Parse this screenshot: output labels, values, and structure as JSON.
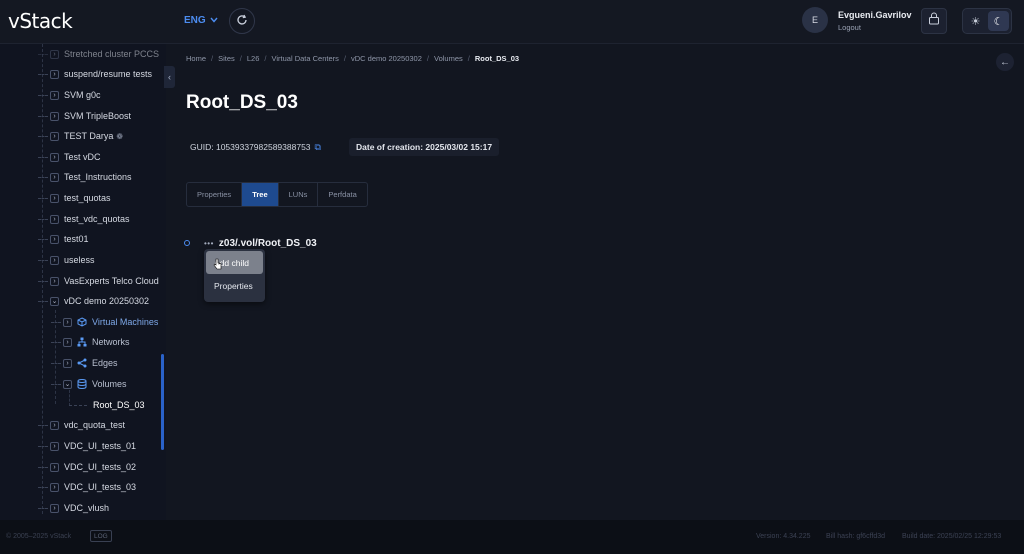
{
  "header": {
    "logo": "vStack",
    "lang": "ENG",
    "user_initial": "E",
    "username": "Evgueni.Gavrilov",
    "logout": "Logout"
  },
  "sidebar": {
    "items": [
      {
        "label": "Stretched cluster PCCS"
      },
      {
        "label": "suspend/resume tests"
      },
      {
        "label": "SVM g0c"
      },
      {
        "label": "SVM TripleBoost"
      },
      {
        "label": "TEST Darya"
      },
      {
        "label": "Test vDC"
      },
      {
        "label": "Test_Instructions"
      },
      {
        "label": "test_quotas"
      },
      {
        "label": "test_vdc_quotas"
      },
      {
        "label": "test01"
      },
      {
        "label": "useless"
      },
      {
        "label": "VasExperts Telco Cloud"
      },
      {
        "label": "vDC demo 20250302"
      },
      {
        "label": "Virtual Machines"
      },
      {
        "label": "Networks"
      },
      {
        "label": "Edges"
      },
      {
        "label": "Volumes"
      },
      {
        "label": "Root_DS_03"
      },
      {
        "label": "vdc_quota_test"
      },
      {
        "label": "VDC_UI_tests_01"
      },
      {
        "label": "VDC_UI_tests_02"
      },
      {
        "label": "VDC_UI_tests_03"
      },
      {
        "label": "VDC_vlush"
      }
    ]
  },
  "breadcrumb": [
    "Home",
    "Sites",
    "L26",
    "Virtual Data Centers",
    "vDC demo 20250302",
    "Volumes",
    "Root_DS_03"
  ],
  "page": {
    "title": "Root_DS_03",
    "guid": "GUID: 10539337982589388753",
    "date": "Date of creation: 2025/03/02 15:17"
  },
  "tabs": [
    "Properties",
    "Tree",
    "LUNs",
    "Perfdata"
  ],
  "tree_node": {
    "menu": "•••",
    "label": "z03/.vol/Root_DS_03"
  },
  "context_menu": {
    "items": [
      "Add child",
      "Properties"
    ]
  },
  "footer": {
    "copyright": "© 2005–2025 vStack",
    "log": "LOG",
    "version": "Version: 4.34.225",
    "build_hash": "Bill hash: gf6cffd3d",
    "build_date": "Build date: 2025/02/25 12:29:53"
  }
}
